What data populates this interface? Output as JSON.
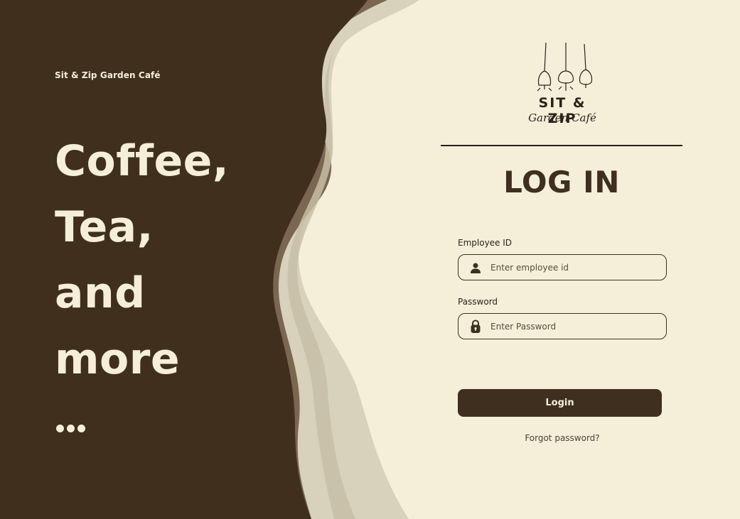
{
  "left_panel": {
    "brand_name": "Sit & Zip Garden Café",
    "tagline_lines": [
      "Coffee,",
      "Tea,",
      "and",
      "more"
    ],
    "ellipsis": "..."
  },
  "logo": {
    "title": "SIT & ZIP",
    "script": "Garden Café",
    "icon": "hanging-lamps-icon"
  },
  "form": {
    "heading": "LOG IN",
    "employee_id": {
      "label": "Employee ID",
      "placeholder": "Enter employee id",
      "value": "",
      "icon": "user-icon"
    },
    "password": {
      "label": "Password",
      "placeholder": "Enter Password",
      "value": "",
      "icon": "lock-icon"
    },
    "login_label": "Login",
    "forgot_label": "Forgot password?"
  },
  "colors": {
    "dark_brown": "#412f1e",
    "cream": "#f5efda",
    "wave_mid": "#7b6651",
    "wave_light": "#d8d1bc",
    "button": "#3e2f1f"
  }
}
